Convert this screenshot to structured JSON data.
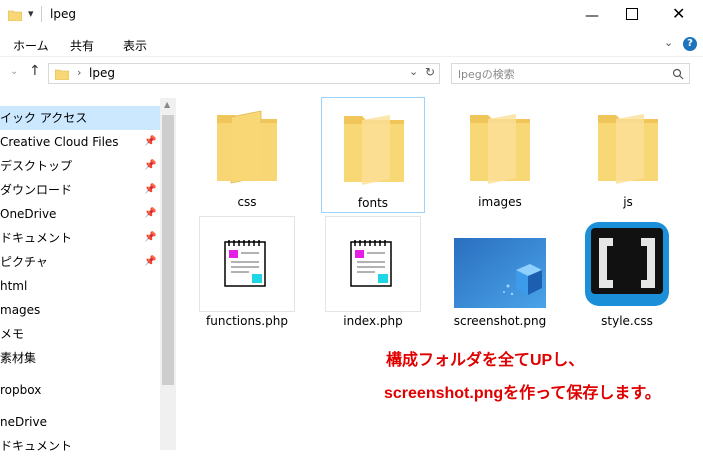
{
  "window": {
    "title": "lpeg"
  },
  "ribbon": {
    "tabs": [
      "ホーム",
      "共有",
      "表示"
    ]
  },
  "address": {
    "path_segment": "lpeg",
    "search_placeholder": "lpegの検索"
  },
  "nav": {
    "items": [
      {
        "label": "イック アクセス",
        "pinned": false,
        "selected": true
      },
      {
        "label": "Creative Cloud Files",
        "pinned": true
      },
      {
        "label": "デスクトップ",
        "pinned": true
      },
      {
        "label": "ダウンロード",
        "pinned": true
      },
      {
        "label": "OneDrive",
        "pinned": true
      },
      {
        "label": "ドキュメント",
        "pinned": true
      },
      {
        "label": "ピクチャ",
        "pinned": true
      },
      {
        "label": "html",
        "pinned": false
      },
      {
        "label": "mages",
        "pinned": false
      },
      {
        "label": "メモ",
        "pinned": false
      },
      {
        "label": "素材集",
        "pinned": false
      },
      {
        "label": "ropbox",
        "pinned": false
      },
      {
        "label": "neDrive",
        "pinned": false
      },
      {
        "label": "ドキュメント",
        "pinned": false
      }
    ]
  },
  "files": [
    {
      "name": "css",
      "type": "folder"
    },
    {
      "name": "fonts",
      "type": "folder",
      "selected": true
    },
    {
      "name": "images",
      "type": "folder"
    },
    {
      "name": "js",
      "type": "folder"
    },
    {
      "name": "functions.php",
      "type": "php"
    },
    {
      "name": "index.php",
      "type": "php"
    },
    {
      "name": "screenshot.png",
      "type": "image"
    },
    {
      "name": "style.css",
      "type": "brackets"
    }
  ],
  "annotation": {
    "line1": "構成フォルダを全てUPし、",
    "line2": "screenshot.pngを作って保存します。"
  },
  "colors": {
    "folder": "#f8d775",
    "accent": "#1e73be",
    "note": "#e00000"
  }
}
